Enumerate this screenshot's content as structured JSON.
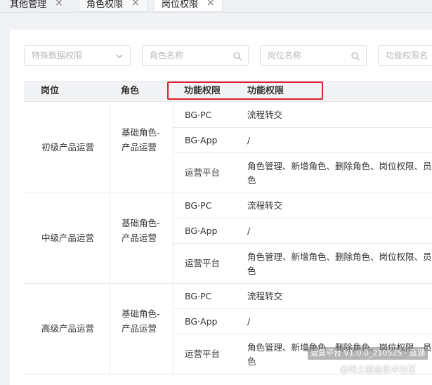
{
  "tabs": [
    {
      "label": "其他管理",
      "close": "×"
    },
    {
      "label": "角色权限",
      "close": "×"
    },
    {
      "label": "岗位权限",
      "close": "×"
    }
  ],
  "filters": {
    "special_data_permission": {
      "placeholder": "特殊数据权限",
      "icon": "chevron-down-icon"
    },
    "role_name": {
      "placeholder": "角色名称",
      "icon": "search-icon"
    },
    "position_name": {
      "placeholder": "岗位名称",
      "icon": "search-icon"
    },
    "function_permission_name": {
      "placeholder": "功能权限名"
    }
  },
  "table": {
    "headers": {
      "position": "岗位",
      "role": "角色",
      "func_perm_1": "功能权限",
      "func_perm_2": "功能权限"
    },
    "groups": [
      {
        "position": "初级产品运营",
        "role": "基础角色-产品运营",
        "rows": [
          {
            "platform": "BG·PC",
            "permissions": "流程转交"
          },
          {
            "platform": "BG·App",
            "permissions": "/"
          },
          {
            "platform": "运营平台",
            "permissions": "角色管理、新增角色、删除角色、岗位权限、员角色"
          }
        ]
      },
      {
        "position": "中级产品运营",
        "role": "基础角色-产品运营",
        "rows": [
          {
            "platform": "BG·PC",
            "permissions": "流程转交"
          },
          {
            "platform": "BG·App",
            "permissions": "/"
          },
          {
            "platform": "运营平台",
            "permissions": "角色管理、新增角色、删除角色、岗位权限、员角色"
          }
        ]
      },
      {
        "position": "高级产品运营",
        "role": "基础角色-产品运营",
        "rows": [
          {
            "platform": "BG·PC",
            "permissions": "流程转交"
          },
          {
            "platform": "BG·App",
            "permissions": "/"
          },
          {
            "platform": "运营平台",
            "permissions": "角色管理、新增角色、删除角色、岗位权限、员角色"
          }
        ]
      }
    ]
  },
  "watermarks": {
    "version": "运营平台 V1.0.0_210525 · 蓝湖",
    "community": "@稀土掘金技术社区"
  },
  "colors": {
    "highlight_border": "#e0202c",
    "header_bg": "#f2f3f5"
  }
}
